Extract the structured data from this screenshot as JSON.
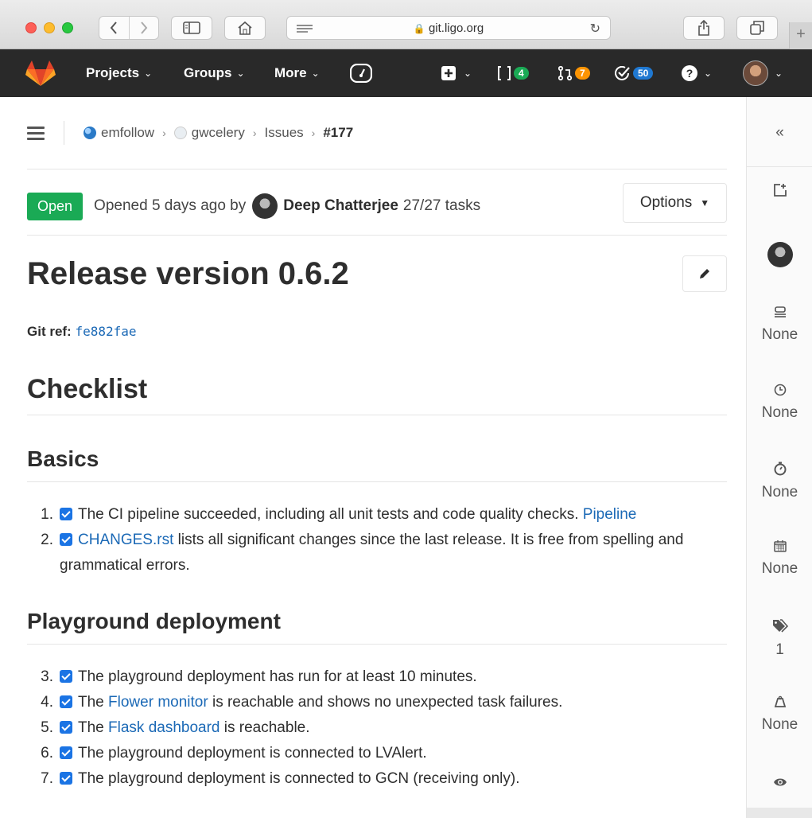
{
  "browser": {
    "url": "git.ligo.org",
    "new_tab": "+"
  },
  "navbar": {
    "projects": "Projects",
    "groups": "Groups",
    "more": "More",
    "issues_count": "4",
    "mr_count": "7",
    "todos_count": "50"
  },
  "breadcrumb": {
    "group": "emfollow",
    "project": "gwcelery",
    "section": "Issues",
    "issue": "#177"
  },
  "issue": {
    "status": "Open",
    "opened_prefix": "Opened 5 days ago by",
    "author": "Deep Chatterjee",
    "tasks": "27/27 tasks",
    "options_label": "Options",
    "title": "Release version 0.6.2",
    "gitref_label": "Git ref:",
    "gitref_value": "fe882fae"
  },
  "content": {
    "checklist_heading": "Checklist",
    "basics_heading": "Basics",
    "basics": [
      {
        "num": "1.",
        "pre": "The CI pipeline succeeded, including all unit tests and code quality checks. ",
        "link": "Pipeline",
        "post": ""
      },
      {
        "num": "2.",
        "pre": "",
        "link": "CHANGES.rst",
        "post": " lists all significant changes since the last release. It is free from spelling and grammatical errors."
      }
    ],
    "playground_heading": "Playground deployment",
    "playground": [
      {
        "num": "3.",
        "pre": "The playground deployment has run for at least 10 minutes.",
        "link": "",
        "post": ""
      },
      {
        "num": "4.",
        "pre": "The ",
        "link": "Flower monitor",
        "post": " is reachable and shows no unexpected task failures."
      },
      {
        "num": "5.",
        "pre": "The ",
        "link": "Flask dashboard",
        "post": " is reachable."
      },
      {
        "num": "6.",
        "pre": "The playground deployment is connected to LVAlert.",
        "link": "",
        "post": ""
      },
      {
        "num": "7.",
        "pre": "The playground deployment is connected to GCN (receiving only).",
        "link": "",
        "post": ""
      }
    ]
  },
  "sidebar": {
    "collapse": "«",
    "milestone": "None",
    "time_tracking": "None",
    "timer": "None",
    "due_date": "None",
    "labels": "1",
    "weight": "None"
  }
}
